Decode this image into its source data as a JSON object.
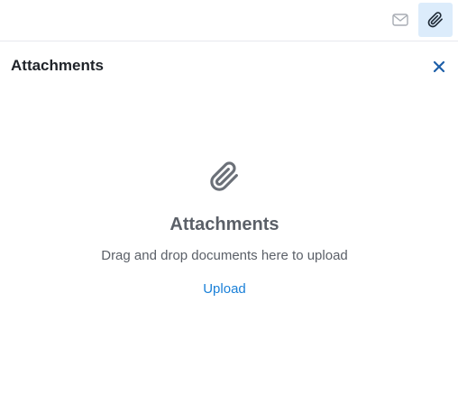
{
  "toolbar": {
    "mail_icon": "envelope-icon",
    "attach_icon": "paperclip-icon",
    "active_bg": "#dcecfb"
  },
  "panel": {
    "title": "Attachments",
    "close_icon": "close-icon"
  },
  "empty_state": {
    "icon": "paperclip-icon",
    "title": "Attachments",
    "description": "Drag and drop documents here to upload",
    "upload_label": "Upload"
  },
  "colors": {
    "accent": "#1a80d8",
    "close": "#1d5fa8",
    "muted_text": "#5b6068",
    "title_text": "#1f2329"
  }
}
